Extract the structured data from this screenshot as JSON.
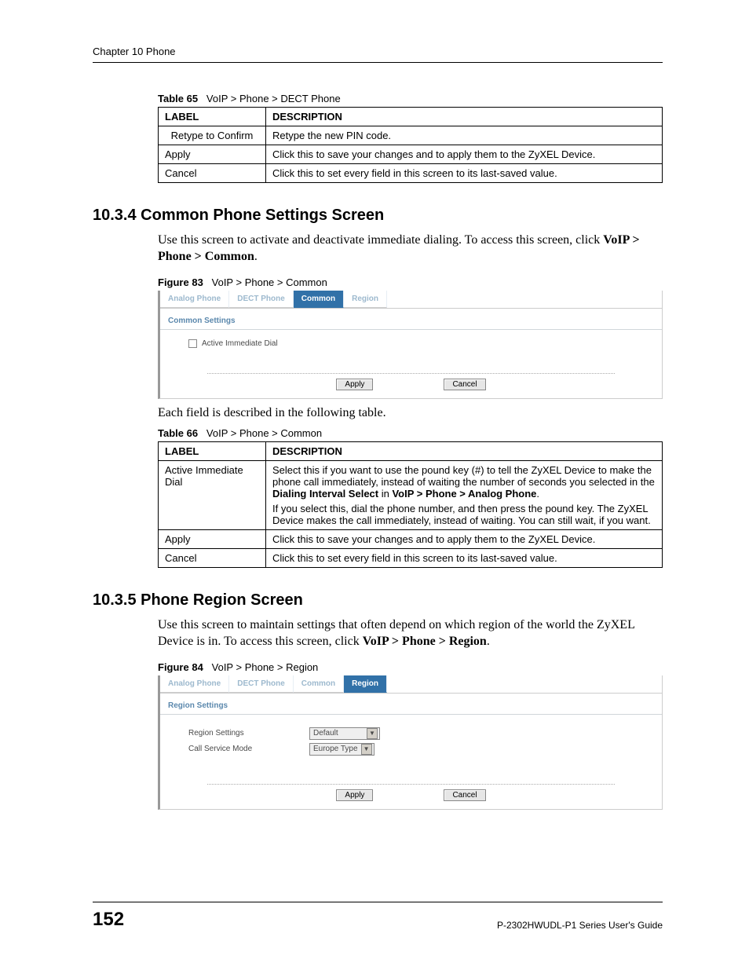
{
  "header": {
    "chapter": "Chapter 10 Phone"
  },
  "table65": {
    "caption_label": "Table 65",
    "caption_text": "VoIP > Phone > DECT Phone",
    "head_label": "LABEL",
    "head_desc": "DESCRIPTION",
    "rows": [
      {
        "label": "Retype to Confirm",
        "desc": "Retype the new PIN code."
      },
      {
        "label": "Apply",
        "desc": "Click this to save your changes and to apply them to the ZyXEL Device."
      },
      {
        "label": "Cancel",
        "desc": "Click this to set every field in this screen to its last-saved value."
      }
    ]
  },
  "section1034": {
    "heading": "10.3.4  Common Phone Settings Screen",
    "intro_pre": "Use this screen to activate and deactivate immediate dialing. To access this screen, click ",
    "intro_bold": "VoIP > Phone > Common",
    "intro_post": "."
  },
  "figure83": {
    "caption_label": "Figure 83",
    "caption_text": "VoIP > Phone > Common",
    "tabs": [
      "Analog Phone",
      "DECT Phone",
      "Common",
      "Region"
    ],
    "active_tab_index": 2,
    "section_title": "Common Settings",
    "checkbox_label": "Active Immediate Dial",
    "btn_apply": "Apply",
    "btn_cancel": "Cancel"
  },
  "after_fig83": "Each field is described in the following table.",
  "table66": {
    "caption_label": "Table 66",
    "caption_text": "VoIP > Phone > Common",
    "head_label": "LABEL",
    "head_desc": "DESCRIPTION",
    "row0_label": "Active Immediate Dial",
    "row0_p1_pre": "Select this if you want to use the pound key (#) to tell the ZyXEL Device to make the phone call immediately, instead of waiting the number of seconds you selected in the ",
    "row0_p1_bold1": "Dialing Interval Select",
    "row0_p1_mid": " in ",
    "row0_p1_bold2": "VoIP > Phone > Analog Phone",
    "row0_p1_post": ".",
    "row0_p2": "If you select this, dial the phone number, and then press the pound key. The ZyXEL Device makes the call immediately, instead of waiting. You can still wait, if you want.",
    "row1_label": "Apply",
    "row1_desc": "Click this to save your changes and to apply them to the ZyXEL Device.",
    "row2_label": "Cancel",
    "row2_desc": "Click this to set every field in this screen to its last-saved value."
  },
  "section1035": {
    "heading": "10.3.5  Phone Region Screen",
    "intro_pre": "Use this screen to maintain settings that often depend on which region of the world the ZyXEL Device is in. To access this screen, click ",
    "intro_bold": "VoIP > Phone > Region",
    "intro_post": "."
  },
  "figure84": {
    "caption_label": "Figure 84",
    "caption_text": "VoIP > Phone > Region",
    "tabs": [
      "Analog Phone",
      "DECT Phone",
      "Common",
      "Region"
    ],
    "active_tab_index": 3,
    "section_title": "Region Settings",
    "row1_label": "Region Settings",
    "row1_value": "Default",
    "row2_label": "Call Service Mode",
    "row2_value": "Europe Type",
    "btn_apply": "Apply",
    "btn_cancel": "Cancel"
  },
  "footer": {
    "page": "152",
    "guide": "P-2302HWUDL-P1 Series User's Guide"
  }
}
